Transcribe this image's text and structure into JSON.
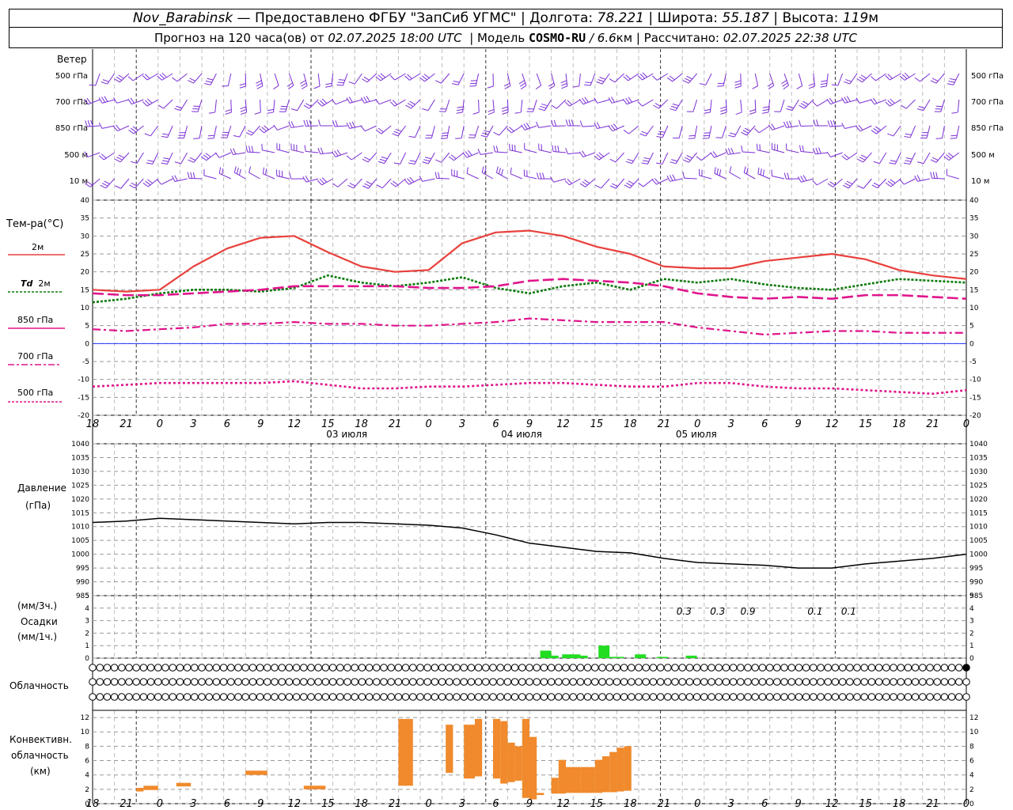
{
  "header": {
    "station": "Nov_Barabinsk",
    "dash": "—",
    "provider": "Предоставлено ФГБУ \"ЗапСиб УГМС\"",
    "lon_label": "Долгота:",
    "lon_value": "78.221",
    "lat_label": "Широта:",
    "lat_value": "55.187",
    "alt_label": "Высота:",
    "alt_value": "119",
    "alt_unit": "м",
    "forecast_label": "Прогноз на 120 часа(ов) от",
    "forecast_time": "02.07.2025 18:00 UTC",
    "model_label": "| Модель",
    "model_name": "COSMO-RU",
    "model_res": "/ 6.6",
    "model_res_unit": "км",
    "calc_label": "| Рассчитано:",
    "calc_time": "02.07.2025 22:38 UTC"
  },
  "labels": {
    "wind": "Ветер",
    "wind_levels": [
      "500 гПа",
      "700 гПа",
      "850 гПа",
      "500 м",
      "10  м"
    ],
    "temp": "Тем-ра(°С)",
    "t2m": "2м",
    "td": "Td",
    "td2": "2м",
    "p850": "850 гПа",
    "p700": "700 гПа",
    "p500": "500 гПа",
    "pressure1": "Давление",
    "pressure2": "(гПа)",
    "precip1": "(мм/3ч.)",
    "precip2": "Осадки",
    "precip3": "(мм/1ч.)",
    "cloud": "Облачность",
    "conv1": "Конвективн.",
    "conv2": "облачность",
    "conv3": "(км)"
  },
  "colors": {
    "wind": "#7b2fd6",
    "t2m": "#e8413c",
    "td": "#0a7a0a",
    "magenta": "#e0148c",
    "zero": "#2233ff",
    "precip": "#22dd22",
    "conv": "#f08a2c"
  },
  "chart_data": {
    "x_hours": [
      18,
      21,
      0,
      3,
      6,
      9,
      12,
      15,
      18,
      21,
      0,
      3,
      6,
      9,
      12,
      15,
      18,
      21,
      0,
      3,
      6,
      9,
      12,
      15,
      18,
      21,
      0
    ],
    "x_tick_labels": [
      "18",
      "21",
      "0",
      "3",
      "6",
      "9",
      "12",
      "15",
      "18",
      "21",
      "0",
      "3",
      "6",
      "9",
      "12",
      "15",
      "18",
      "21",
      "0",
      "3",
      "6",
      "9",
      "12",
      "15",
      "18",
      "21",
      "0"
    ],
    "day_labels": [
      "03 июля",
      "04 июля",
      "05 июля"
    ],
    "temperature": {
      "type": "line",
      "ylim": [
        -20,
        40
      ],
      "yticks": [
        -20,
        -15,
        -10,
        -5,
        0,
        5,
        10,
        15,
        20,
        25,
        30,
        35,
        40
      ],
      "series": [
        {
          "key": "t2m",
          "values": [
            15.0,
            14.5,
            15.0,
            21.5,
            26.5,
            29.5,
            30.0,
            25.5,
            21.5,
            20.0,
            20.5,
            28.0,
            31.0,
            31.5,
            30.0,
            27.0,
            25.0,
            21.5,
            21.0,
            21.0,
            23.0,
            24.0,
            25.0,
            23.5,
            20.5,
            19.0,
            18.0
          ]
        },
        {
          "key": "td",
          "values": [
            11.5,
            12.5,
            14.0,
            15.0,
            15.0,
            14.5,
            15.5,
            19.0,
            17.0,
            16.0,
            17.0,
            18.5,
            15.5,
            14.0,
            16.0,
            17.0,
            15.0,
            18.0,
            17.0,
            18.0,
            16.5,
            15.5,
            15.0,
            16.5,
            18.0,
            17.5,
            17.0
          ]
        },
        {
          "key": "p850",
          "values": [
            14.0,
            13.5,
            13.5,
            14.0,
            14.5,
            15.0,
            16.0,
            16.0,
            16.0,
            16.0,
            15.5,
            15.5,
            16.0,
            17.5,
            18.0,
            17.5,
            17.0,
            16.0,
            14.0,
            13.0,
            12.5,
            13.0,
            12.5,
            13.5,
            13.5,
            13.0,
            12.5
          ]
        },
        {
          "key": "p700",
          "values": [
            4.0,
            3.5,
            4.0,
            4.5,
            5.5,
            5.5,
            6.0,
            5.5,
            5.5,
            5.0,
            5.0,
            5.5,
            6.0,
            7.0,
            6.5,
            6.0,
            6.0,
            6.0,
            4.5,
            3.5,
            2.5,
            3.0,
            3.5,
            3.5,
            3.0,
            3.0,
            3.0
          ]
        },
        {
          "key": "p500",
          "values": [
            -12.0,
            -11.5,
            -11.0,
            -11.0,
            -11.0,
            -11.0,
            -10.5,
            -11.5,
            -12.5,
            -12.5,
            -12.0,
            -12.0,
            -11.5,
            -11.0,
            -11.0,
            -11.5,
            -12.0,
            -12.0,
            -11.0,
            -11.0,
            -12.0,
            -12.5,
            -12.5,
            -13.0,
            -13.5,
            -14.0,
            -13.0
          ]
        }
      ]
    },
    "pressure": {
      "type": "line",
      "ylim": [
        985,
        1040
      ],
      "yticks": [
        985,
        990,
        995,
        1000,
        1005,
        1010,
        1015,
        1020,
        1025,
        1030,
        1035,
        1040
      ],
      "values": [
        1011.5,
        1012.0,
        1013.0,
        1012.5,
        1012.0,
        1011.5,
        1011.0,
        1011.5,
        1011.5,
        1011.0,
        1010.5,
        1009.5,
        1007.0,
        1004.0,
        1002.5,
        1001.0,
        1000.5,
        998.5,
        997.0,
        996.5,
        996.0,
        995.0,
        995.0,
        996.5,
        997.5,
        998.5,
        1000.0
      ]
    },
    "precip": {
      "type": "bar",
      "ylim": [
        0,
        5
      ],
      "yticks": [
        0,
        1,
        2,
        3,
        4,
        5
      ],
      "labels_3h": [
        {
          "hour_index": 17.6,
          "text": "0.3"
        },
        {
          "hour_index": 18.6,
          "text": "0.3"
        },
        {
          "hour_index": 19.5,
          "text": "0.9"
        },
        {
          "hour_index": 21.5,
          "text": "0.1"
        },
        {
          "hour_index": 22.5,
          "text": "0.1"
        }
      ],
      "bars_1h": [
        {
          "h": 63,
          "v": 0.6
        },
        {
          "h": 64,
          "v": 0.2
        },
        {
          "h": 66,
          "v": 0.3
        },
        {
          "h": 67,
          "v": 0.3
        },
        {
          "h": 68,
          "v": 0.2
        },
        {
          "h": 71,
          "v": 1.0
        },
        {
          "h": 72,
          "v": 0.1
        },
        {
          "h": 73,
          "v": 0.1
        },
        {
          "h": 76,
          "v": 0.3
        },
        {
          "h": 79,
          "v": 0.1
        },
        {
          "h": 83,
          "v": 0.2
        }
      ]
    },
    "cloud_rows": {
      "low": [
        0,
        0,
        0,
        0,
        0,
        0,
        0,
        0,
        0,
        0,
        0,
        0,
        0,
        0,
        0,
        0,
        0,
        0,
        0,
        0,
        0,
        0,
        0,
        0,
        0,
        0,
        0,
        0,
        0,
        0,
        0,
        0,
        0,
        0,
        0,
        0,
        0,
        0,
        0,
        0,
        0,
        0,
        0,
        0,
        0,
        0,
        0,
        0,
        0,
        0,
        0,
        0,
        0,
        0,
        0,
        0,
        0,
        0,
        0,
        0,
        0,
        0,
        0,
        0,
        0,
        0,
        0,
        0,
        0,
        0,
        0,
        0,
        0,
        0,
        0,
        0,
        0,
        0,
        0,
        0,
        0,
        0,
        0,
        0,
        0,
        0,
        0,
        0,
        0,
        0,
        0,
        0,
        0,
        0,
        0,
        0,
        0,
        0,
        0,
        0,
        0,
        0,
        0,
        0,
        0,
        0,
        0,
        0,
        0,
        0,
        0,
        0,
        0,
        0,
        0,
        0,
        0,
        0,
        0,
        0,
        4
      ],
      "mid": [
        0,
        0,
        0,
        0,
        0,
        0,
        0,
        0,
        0,
        0,
        0,
        0,
        0,
        0,
        0,
        0,
        0,
        0,
        0,
        0,
        0,
        0,
        0,
        0,
        0,
        0,
        0,
        0,
        0,
        0,
        0,
        0,
        0,
        0,
        0,
        0,
        0,
        0,
        0,
        0,
        0,
        0,
        0,
        0,
        0,
        0,
        0,
        0,
        0,
        0,
        0,
        0,
        0,
        0,
        0,
        0,
        0,
        0,
        0,
        0,
        0,
        0,
        0,
        0,
        0,
        0,
        0,
        0,
        0,
        0,
        0,
        0,
        0,
        0,
        0,
        0,
        0,
        0,
        0,
        0,
        0,
        0,
        0,
        0,
        0,
        0,
        0,
        0,
        0,
        0,
        0,
        0,
        0,
        0,
        0,
        0,
        0,
        0,
        0,
        0,
        0,
        0,
        0,
        0,
        0,
        0,
        0,
        0,
        0,
        0,
        0,
        0,
        0,
        0,
        0,
        0,
        0,
        0,
        0,
        0,
        0
      ],
      "high": [
        0,
        0,
        0,
        0,
        0,
        0,
        0,
        0,
        0,
        0,
        0,
        0,
        0,
        0,
        0,
        0,
        0,
        0,
        0,
        0,
        0,
        0,
        0,
        0,
        0,
        0,
        0,
        0,
        0,
        0,
        0,
        0,
        0,
        0,
        0,
        0,
        0,
        0,
        0,
        0,
        0,
        0,
        0,
        0,
        0,
        0,
        0,
        0,
        0,
        0,
        0,
        0,
        0,
        0,
        0,
        0,
        0,
        0,
        0,
        0,
        0,
        0,
        0,
        0,
        0,
        0,
        0,
        0,
        0,
        0,
        0,
        0,
        0,
        0,
        0,
        0,
        0,
        0,
        0,
        0,
        0,
        0,
        0,
        0,
        0,
        0,
        0,
        0,
        0,
        0,
        0,
        0,
        0,
        0,
        0,
        0,
        0,
        0,
        0,
        0,
        0,
        0,
        0,
        0,
        0,
        0,
        0,
        0,
        0,
        0,
        0,
        0,
        0,
        0,
        0,
        0,
        0,
        0,
        0,
        0,
        0
      ]
    },
    "convective": {
      "type": "bar",
      "ylim": [
        0,
        13
      ],
      "yticks": [
        0,
        2,
        4,
        6,
        8,
        10,
        12
      ],
      "segments": [
        {
          "h0": 6.0,
          "h1": 7.0,
          "bot": 1.7,
          "top": 2.2
        },
        {
          "h0": 7.0,
          "h1": 9.0,
          "bot": 1.9,
          "top": 2.5
        },
        {
          "h0": 11.5,
          "h1": 13.5,
          "bot": 2.4,
          "top": 2.9
        },
        {
          "h0": 21.0,
          "h1": 24.0,
          "bot": 4.0,
          "top": 4.6
        },
        {
          "h0": 29.0,
          "h1": 32.0,
          "bot": 2.0,
          "top": 2.5
        },
        {
          "h0": 42.0,
          "h1": 44.0,
          "bot": 2.5,
          "top": 11.8
        },
        {
          "h0": 48.5,
          "h1": 49.5,
          "bot": 4.3,
          "top": 11.0
        },
        {
          "h0": 51.0,
          "h1": 52.5,
          "bot": 3.5,
          "top": 11.0
        },
        {
          "h0": 52.5,
          "h1": 53.5,
          "bot": 3.8,
          "top": 11.8
        },
        {
          "h0": 55.0,
          "h1": 56.0,
          "bot": 3.5,
          "top": 11.8
        },
        {
          "h0": 56.0,
          "h1": 57.0,
          "bot": 2.8,
          "top": 11.5
        },
        {
          "h0": 57.0,
          "h1": 58.0,
          "bot": 3.0,
          "top": 8.5
        },
        {
          "h0": 58.0,
          "h1": 59.0,
          "bot": 3.2,
          "top": 8.0
        },
        {
          "h0": 59.0,
          "h1": 60.0,
          "bot": 0.8,
          "top": 11.8
        },
        {
          "h0": 60.0,
          "h1": 61.0,
          "bot": 0.6,
          "top": 9.3
        },
        {
          "h0": 61.0,
          "h1": 62.0,
          "bot": 1.2,
          "top": 1.5
        },
        {
          "h0": 63.0,
          "h1": 64.0,
          "bot": 1.4,
          "top": 3.6
        },
        {
          "h0": 64.0,
          "h1": 65.0,
          "bot": 1.4,
          "top": 6.1
        },
        {
          "h0": 65.0,
          "h1": 67.0,
          "bot": 1.5,
          "top": 5.1
        },
        {
          "h0": 67.0,
          "h1": 69.0,
          "bot": 1.5,
          "top": 5.1
        },
        {
          "h0": 69.0,
          "h1": 70.0,
          "bot": 1.5,
          "top": 6.1
        },
        {
          "h0": 70.0,
          "h1": 71.0,
          "bot": 1.6,
          "top": 6.6
        },
        {
          "h0": 71.0,
          "h1": 72.0,
          "bot": 1.6,
          "top": 7.2
        },
        {
          "h0": 72.0,
          "h1": 73.0,
          "bot": 1.7,
          "top": 7.8
        },
        {
          "h0": 73.0,
          "h1": 74.0,
          "bot": 1.8,
          "top": 8.0
        }
      ]
    }
  }
}
